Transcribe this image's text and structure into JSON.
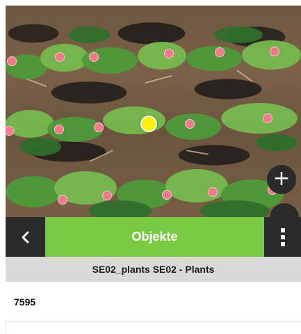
{
  "map": {
    "description_icons": [
      "plus-icon",
      "more-vertical-icon"
    ],
    "marker_color": "#f07a8a",
    "cursor_color": "#fff200"
  },
  "toolbar": {
    "back_icon": "chevron-left-icon",
    "title": "Objekte",
    "menu_icon": "more-vertical-icon",
    "accent_color": "#7ac943"
  },
  "layer": {
    "name": "SE02_plants SE02 - Plants"
  },
  "feature": {
    "value": "7595"
  }
}
